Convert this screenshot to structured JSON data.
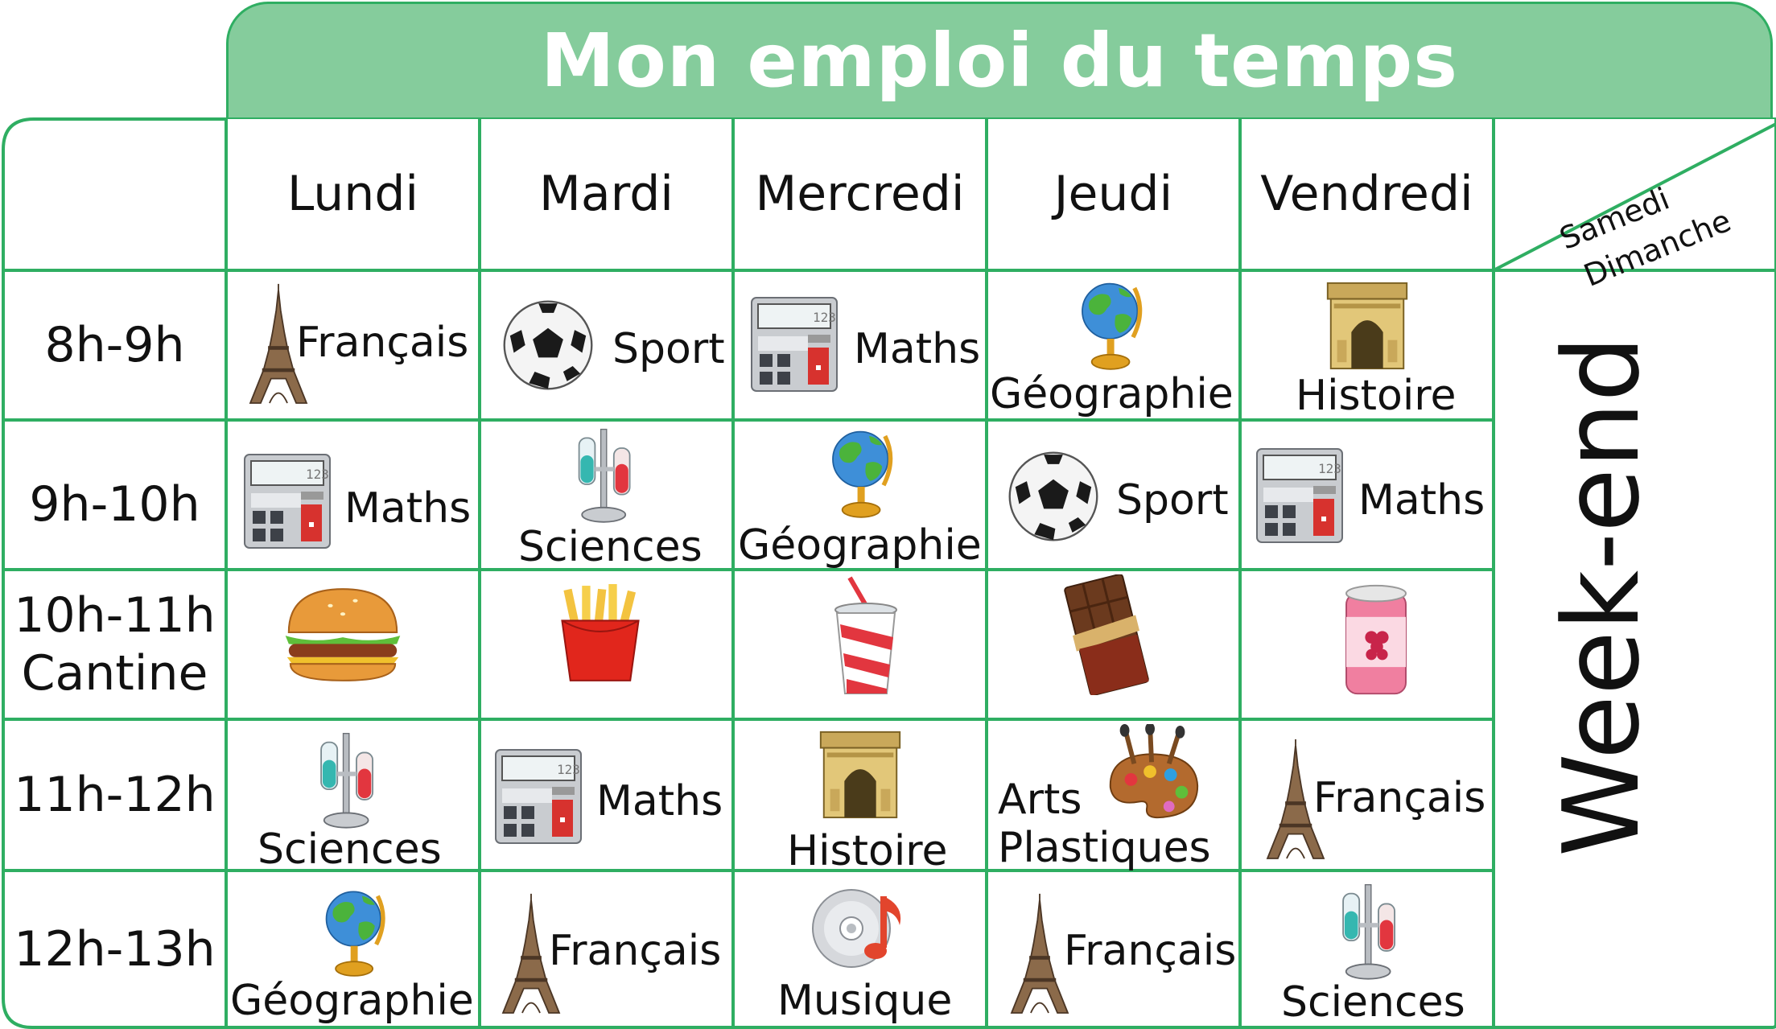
{
  "title": "Mon emploi du temps",
  "days": [
    "Lundi",
    "Mardi",
    "Mercredi",
    "Jeudi",
    "Vendredi"
  ],
  "weekend_header": {
    "top": "Samedi",
    "bottom": "Dimanche"
  },
  "weekend_label": "Week-end",
  "times": [
    {
      "line1": "8h-9h",
      "line2": ""
    },
    {
      "line1": "9h-10h",
      "line2": ""
    },
    {
      "line1": "10h-11h",
      "line2": "Cantine"
    },
    {
      "line1": "11h-12h",
      "line2": ""
    },
    {
      "line1": "12h-13h",
      "line2": ""
    }
  ],
  "rows": [
    [
      {
        "label": "Français",
        "icon": "eiffel-tower-icon"
      },
      {
        "label": "Sport",
        "icon": "soccer-ball-icon"
      },
      {
        "label": "Maths",
        "icon": "calculator-icon"
      },
      {
        "label": "Géographie",
        "icon": "globe-icon"
      },
      {
        "label": "Histoire",
        "icon": "arc-de-triomphe-icon"
      }
    ],
    [
      {
        "label": "Maths",
        "icon": "calculator-icon"
      },
      {
        "label": "Sciences",
        "icon": "test-tubes-icon"
      },
      {
        "label": "Géographie",
        "icon": "globe-icon"
      },
      {
        "label": "Sport",
        "icon": "soccer-ball-icon"
      },
      {
        "label": "Maths",
        "icon": "calculator-icon"
      }
    ],
    [
      {
        "label": "",
        "icon": "hamburger-icon"
      },
      {
        "label": "",
        "icon": "french-fries-icon"
      },
      {
        "label": "",
        "icon": "soda-cup-icon"
      },
      {
        "label": "",
        "icon": "chocolate-bar-icon"
      },
      {
        "label": "",
        "icon": "soda-can-icon"
      }
    ],
    [
      {
        "label": "Sciences",
        "icon": "test-tubes-icon"
      },
      {
        "label": "Maths",
        "icon": "calculator-icon"
      },
      {
        "label": "Histoire",
        "icon": "arc-de-triomphe-icon"
      },
      {
        "label": "Arts\nPlastiques",
        "label_line1": "Arts",
        "label_line2": "Plastiques",
        "icon": "paint-palette-icon"
      },
      {
        "label": "Français",
        "icon": "eiffel-tower-icon"
      }
    ],
    [
      {
        "label": "Géographie",
        "icon": "globe-icon"
      },
      {
        "label": "Français",
        "icon": "eiffel-tower-icon"
      },
      {
        "label": "Musique",
        "icon": "music-cd-icon"
      },
      {
        "label": "Français",
        "icon": "eiffel-tower-icon"
      },
      {
        "label": "Sciences",
        "icon": "test-tubes-icon"
      }
    ]
  ],
  "colors": {
    "grid_line": "#2fae62",
    "title_bg": "#85cc9c",
    "title_text": "#ffffff"
  }
}
